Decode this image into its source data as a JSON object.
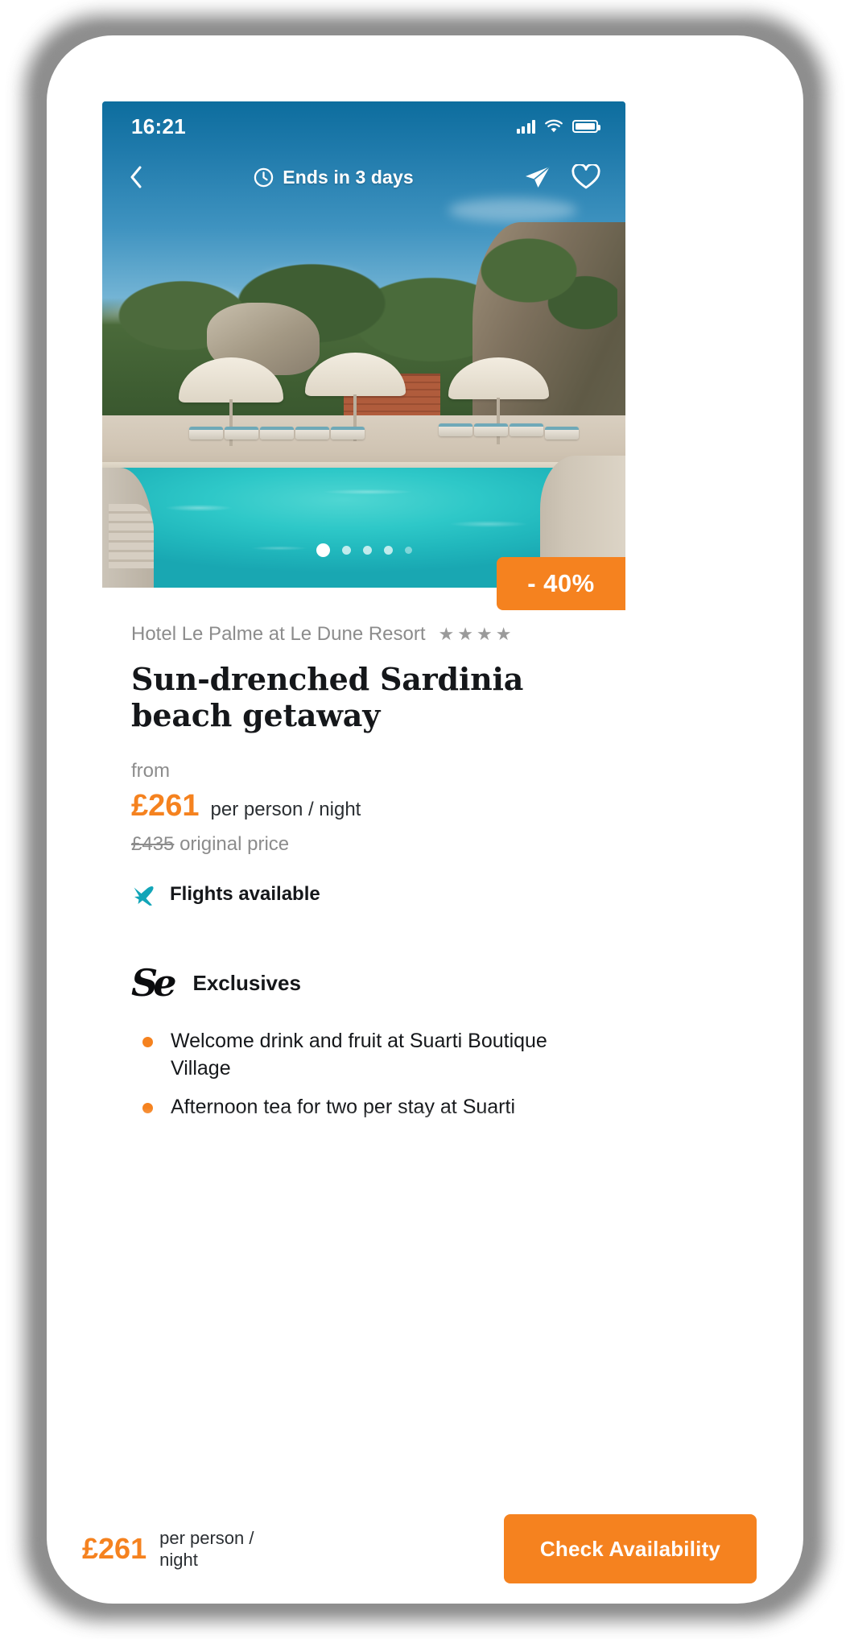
{
  "status_bar": {
    "time": "16:21",
    "signal_icon": "cellular-signal-icon",
    "wifi_icon": "wifi-icon",
    "battery_icon": "battery-icon"
  },
  "nav": {
    "back_icon": "back-chevron-icon",
    "clock_icon": "clock-icon",
    "countdown_label": "Ends in 3 days",
    "share_icon": "share-icon",
    "favourite_icon": "heart-icon"
  },
  "gallery": {
    "total_slides": 5,
    "active_slide": 1,
    "discount_badge": "- 40%"
  },
  "deal": {
    "hotel_name": "Hotel Le Palme at Le Dune Resort",
    "star_rating": 4,
    "star_glyph": "★",
    "title_line_1": "Sun-drenched Sardinia",
    "title_line_2": "beach getaway",
    "from_label": "from",
    "price": "£261",
    "price_unit": "per person / night",
    "original_price": "£435",
    "original_price_suffix": "original price",
    "flights_icon": "airplane-icon",
    "flights_label": "Flights available"
  },
  "exclusives": {
    "logo_text": "Se",
    "logo_icon": "secret-escapes-monogram-icon",
    "title": "Exclusives",
    "items": [
      "Welcome drink and fruit at Suarti Boutique Village",
      "Afternoon tea for two per stay at Suarti"
    ]
  },
  "bottom_bar": {
    "price": "£261",
    "price_unit": "per person / night",
    "cta_label": "Check Availability"
  },
  "colors": {
    "accent_orange": "#f5821f",
    "teal": "#1ba3b5",
    "text_dark": "#15171a",
    "text_muted": "#8c8c8c"
  }
}
